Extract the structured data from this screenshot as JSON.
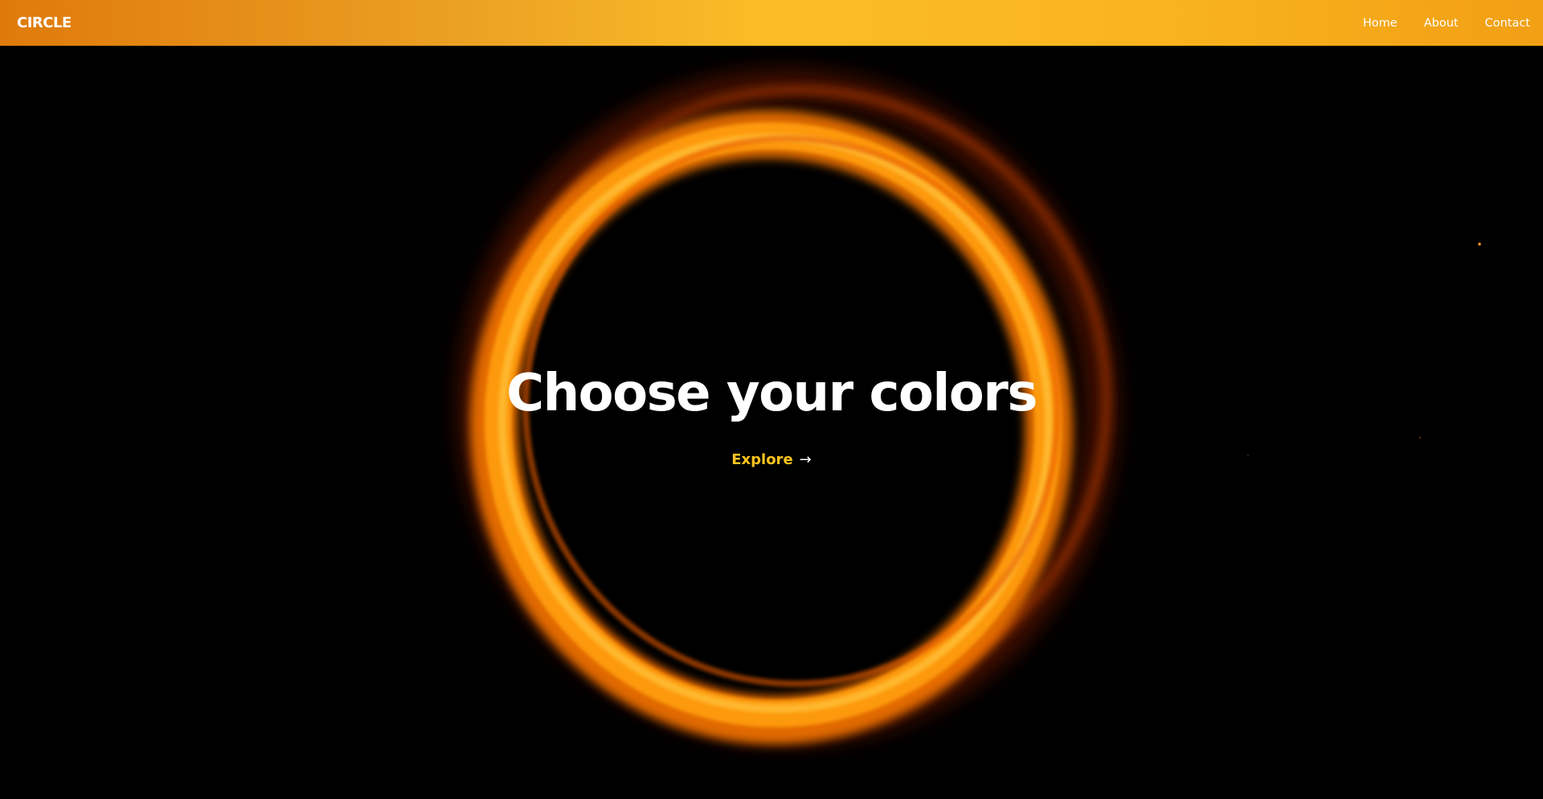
{
  "navbar": {
    "brand": "CIRCLE",
    "links": [
      {
        "label": "Home"
      },
      {
        "label": "About"
      },
      {
        "label": "Contact"
      }
    ],
    "gradient_colors": [
      "#df7a0a",
      "#fbbd26",
      "#f29f14"
    ]
  },
  "hero": {
    "title": "Choose your colors",
    "cta_label": "Explore",
    "cta_icon": "arrow-right-icon",
    "background_color": "#000000",
    "ring_color": "#ff8c00",
    "cta_color": "#fdc31f"
  }
}
